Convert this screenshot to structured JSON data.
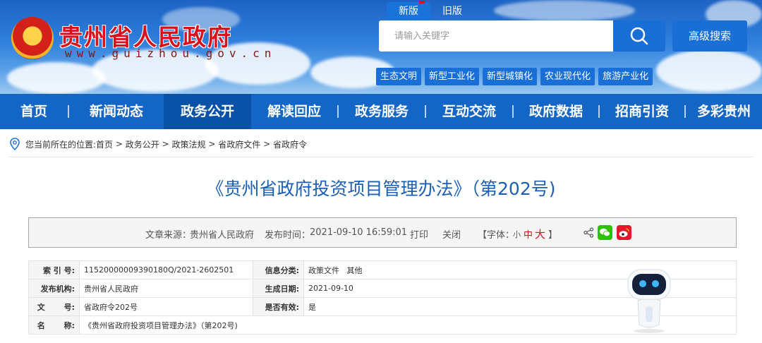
{
  "header": {
    "site_name": "贵州省人民政府",
    "site_url": "www.guizhou.gov.cn",
    "version_tabs": [
      {
        "label": "新版",
        "active": true
      },
      {
        "label": "旧版",
        "active": false
      }
    ],
    "search": {
      "placeholder": "请输入关键字",
      "value": ""
    },
    "advanced_search_label": "高级搜索",
    "topic_tags": [
      "生态文明",
      "新型工业化",
      "新型城镇化",
      "农业现代化",
      "旅游产业化"
    ]
  },
  "nav": {
    "items": [
      {
        "label": "首页",
        "active": false
      },
      {
        "label": "新闻动态",
        "active": false
      },
      {
        "label": "政务公开",
        "active": true
      },
      {
        "label": "解读回应",
        "active": false
      },
      {
        "label": "政务服务",
        "active": false
      },
      {
        "label": "互动交流",
        "active": false
      },
      {
        "label": "政府数据",
        "active": false
      },
      {
        "label": "招商引资",
        "active": false
      },
      {
        "label": "多彩贵州",
        "active": false
      }
    ]
  },
  "breadcrumb": {
    "prefix": "您当前所在的位置:",
    "items": [
      "首页",
      "政务公开",
      "政策法规",
      "省政府文件",
      "省政府令"
    ],
    "separator": ">"
  },
  "article": {
    "title": "《贵州省政府投资项目管理办法》（第202号)",
    "source_label": "文章来源：",
    "source": "贵州省人民政府",
    "publish_label": "发布时间：",
    "publish_time": "2021-09-10 16:59:01",
    "print_label": "打印",
    "close_label": "关闭",
    "font_label": "【字体：",
    "font_small": "小",
    "font_medium": "中",
    "font_large": "大",
    "font_end": "】"
  },
  "meta_table": {
    "rows": [
      {
        "k1": "索 引 号:",
        "v1": "11520000009390180Q/2021-2602501",
        "k2": "信息分类:",
        "v2": "政策文件   其他"
      },
      {
        "k1": "发布机构:",
        "v1": "贵州省人民政府",
        "k2": "生成日期:",
        "v2": "2021-09-10"
      },
      {
        "k1": "文       号:",
        "v1": "省政府令202号",
        "k2": "是否有效:",
        "v2": "是"
      }
    ],
    "name_key": "名       称:",
    "name_value": "《贵州省政府投资项目管理办法》（第202号)"
  },
  "colors": {
    "nav_bg": "#1466c6",
    "nav_active": "#0a52a8",
    "title_blue": "#1b5fb5",
    "accent_red": "#d8121d",
    "wechat_green": "#2dc100",
    "weibo_red": "#e6162d"
  }
}
